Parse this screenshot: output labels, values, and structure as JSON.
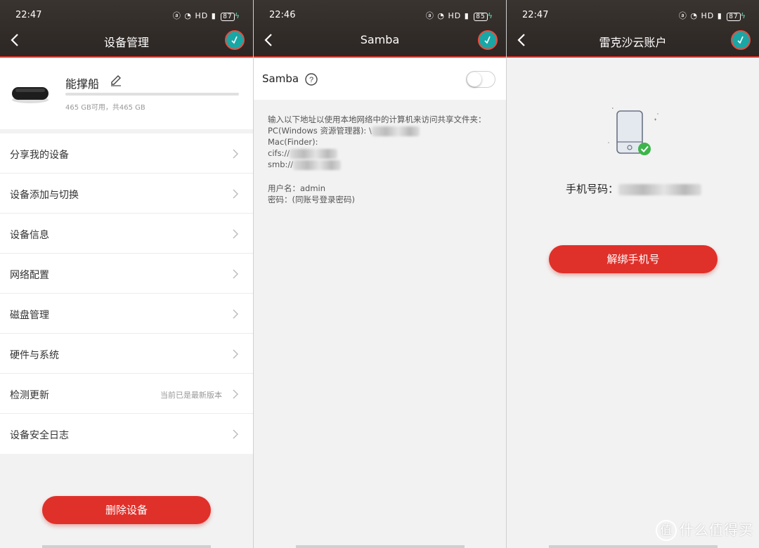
{
  "colors": {
    "accent": "#e0302a",
    "header_bg": "#2f2927",
    "header_underline": "#d8362b",
    "avatar_bg": "#1aa6a5",
    "check_green": "#3cb54a"
  },
  "panels": [
    {
      "status": {
        "time": "22:47",
        "icons": "HD",
        "battery": "87"
      },
      "title": "设备管理",
      "device": {
        "name": "能撑船",
        "storage": "465 GB可用，共465 GB",
        "used_fraction": 0.0
      },
      "menu": [
        {
          "label": "分享我的设备",
          "value": ""
        },
        {
          "label": "设备添加与切换",
          "value": ""
        },
        {
          "label": "设备信息",
          "value": ""
        },
        {
          "label": "网络配置",
          "value": ""
        },
        {
          "label": "磁盘管理",
          "value": ""
        },
        {
          "label": "硬件与系统",
          "value": ""
        },
        {
          "label": "检测更新",
          "value": "当前已是最新版本"
        },
        {
          "label": "设备安全日志",
          "value": ""
        }
      ],
      "button": "删除设备"
    },
    {
      "status": {
        "time": "22:46",
        "icons": "HD",
        "battery": "85"
      },
      "title": "Samba",
      "samba_label": "Samba",
      "toggle_on": false,
      "info_lines": [
        "输入以下地址以使用本地网络中的计算机来访问共享文件夹：",
        "PC(Windows 资源管理器): \\",
        "Mac(Finder):",
        "cifs://",
        "smb://"
      ],
      "account_lines": [
        "用户名：admin",
        "密码：(同账号登录密码)"
      ]
    },
    {
      "status": {
        "time": "22:47",
        "icons": "HD",
        "battery": "87"
      },
      "title": "雷克沙云账户",
      "phone_label": "手机号码：",
      "button": "解绑手机号",
      "watermark": "什么值得买",
      "watermark_mark": "值"
    }
  ]
}
